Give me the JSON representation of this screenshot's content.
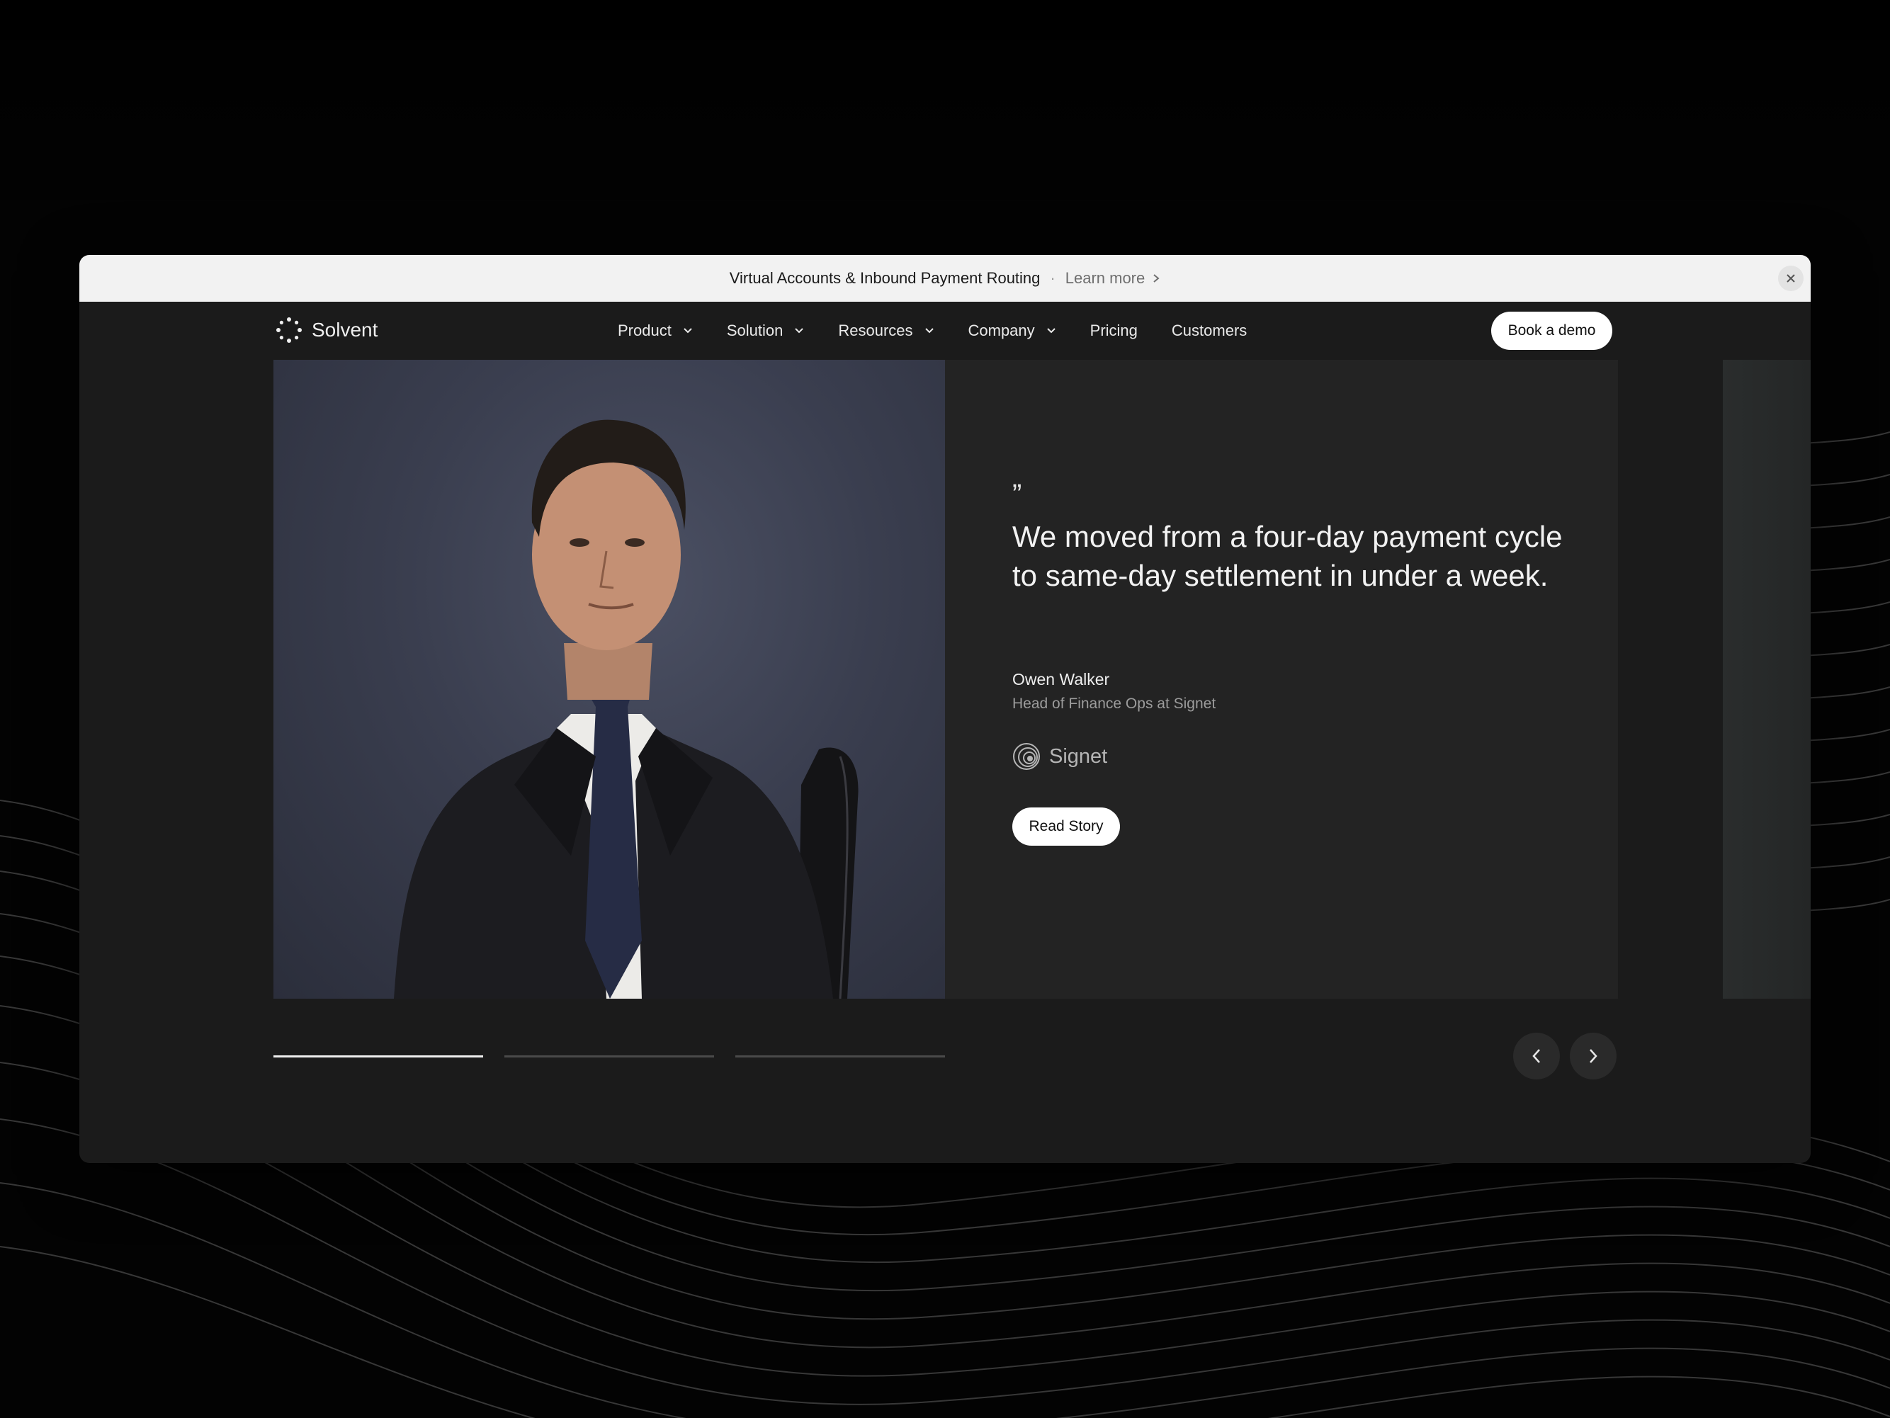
{
  "colors": {
    "accent": "#ffffff",
    "surface": "#1b1b1b",
    "card": "#232323",
    "banner": "#f2f2f2"
  },
  "announcement": {
    "text": "Virtual Accounts & Inbound Payment Routing",
    "separator": "·",
    "link_label": "Learn more",
    "link_icon": "chevron-right-icon",
    "close_icon": "close-icon"
  },
  "nav": {
    "brand": "Solvent",
    "brand_icon": "sparkle-logo-icon",
    "items": [
      {
        "label": "Product",
        "has_dropdown": true
      },
      {
        "label": "Solution",
        "has_dropdown": true
      },
      {
        "label": "Resources",
        "has_dropdown": true
      },
      {
        "label": "Company",
        "has_dropdown": true
      },
      {
        "label": "Pricing",
        "has_dropdown": false
      },
      {
        "label": "Customers",
        "has_dropdown": false
      }
    ],
    "cta_label": "Book a demo"
  },
  "testimonial": {
    "quote_mark": "”",
    "quote": "We moved from a four-day payment cycle to same-day settlement in under a week.",
    "author": "Owen Walker",
    "role": "Head of Finance Ops at Signet",
    "company": "Signet",
    "company_icon": "concentric-circles-logo-icon",
    "cta_label": "Read Story"
  },
  "carousel": {
    "slide_count": 3,
    "active_index": 0,
    "prev_icon": "chevron-left-icon",
    "next_icon": "chevron-right-icon"
  }
}
